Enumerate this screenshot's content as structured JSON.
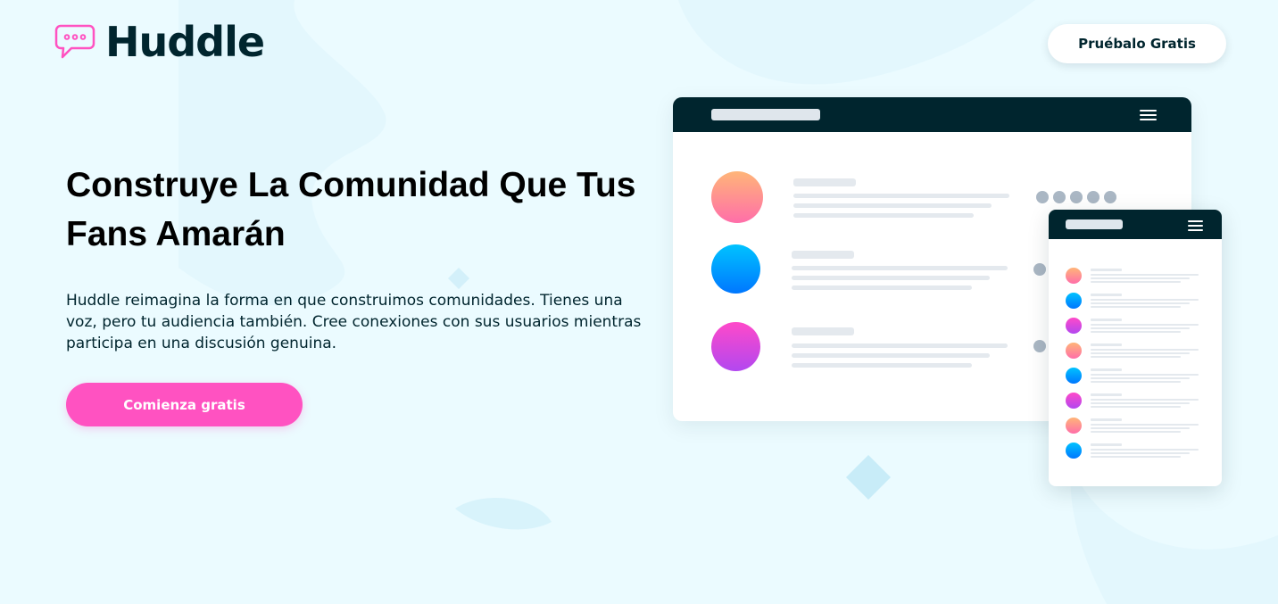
{
  "brand": {
    "name": "Huddle",
    "icon": "chat-bubble-icon",
    "accent_color": "#ff52c1",
    "dark_color": "#00252e",
    "background_color": "#ebfbff"
  },
  "header": {
    "cta_label": "Pruébalo Gratis"
  },
  "hero": {
    "title": "Construye La Comunidad Que Tus Fans Amarán",
    "description": "Huddle reimagina la forma en que construimos comunidades. Tienes una voz, pero tu audiencia también. Cree conexiones con sus usuarios mientras participa en una discusión genuina.",
    "cta_label": "Comienza gratis"
  },
  "illustration": {
    "desktop_rows": [
      "orange-avatar",
      "blue-avatar",
      "purple-avatar"
    ],
    "mobile_rows": [
      "orange-avatar",
      "blue-avatar",
      "purple-avatar",
      "orange-avatar",
      "blue-avatar",
      "purple-avatar",
      "orange-avatar",
      "blue-avatar"
    ],
    "menu_icon": "hamburger-menu-icon"
  }
}
